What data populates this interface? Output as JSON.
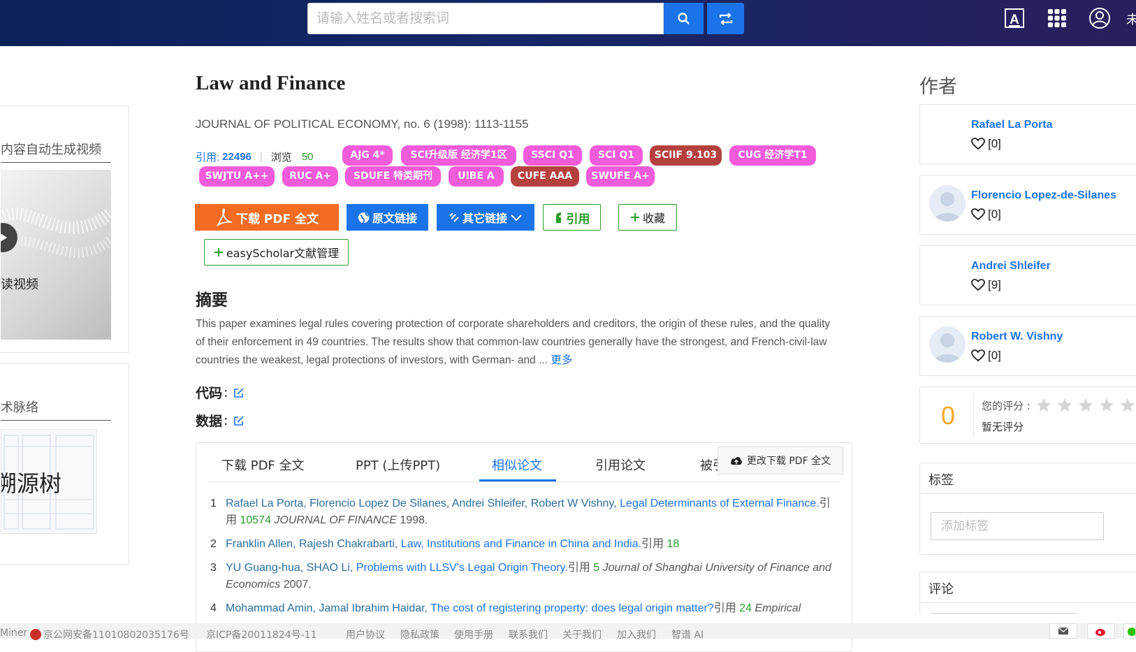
{
  "header": {
    "search_placeholder": "请输入姓名或者搜索词",
    "user_truncated": "未"
  },
  "left": {
    "video_card_title": "内容自动生成视频",
    "video_caption": "读视频",
    "map_card_title": "术脉络",
    "map_caption": "溯源树"
  },
  "paper": {
    "title": "Law and Finance",
    "journal": "JOURNAL OF POLITICAL ECONOMY, no. 6 (1998): 1113-1155",
    "cite_label": "引用:",
    "cite_count": "22496",
    "views_label": "浏览",
    "views_count": "50"
  },
  "tags": [
    {
      "label": "AJG 4*",
      "color": "#f25bd9"
    },
    {
      "label": "SCI升级版 经济学1区",
      "color": "#f25bd9"
    },
    {
      "label": "SSCI Q1",
      "color": "#f25bd9"
    },
    {
      "label": "SCI Q1",
      "color": "#f25bd9"
    },
    {
      "label": "SCIIF 9.103",
      "color": "#b5413f"
    },
    {
      "label": "CUG 经济学T1",
      "color": "#f25bd9"
    },
    {
      "label": "SWJTU A++",
      "color": "#f25bd9"
    },
    {
      "label": "RUC A+",
      "color": "#f25bd9"
    },
    {
      "label": "SDUFE 特类期刊",
      "color": "#f25bd9"
    },
    {
      "label": "UIBE A",
      "color": "#f25bd9"
    },
    {
      "label": "CUFE AAA",
      "color": "#b5413f"
    },
    {
      "label": "SWUFE A+",
      "color": "#f25bd9"
    }
  ],
  "actions": {
    "download_pdf": "下载 PDF 全文",
    "original_link": "原文链接",
    "other_links": "其它链接",
    "cite": "引用",
    "favorite": "收藏",
    "easyscholar": "easyScholar文献管理"
  },
  "abstract": {
    "heading": "摘要",
    "text": "This paper examines legal rules covering protection of corporate shareholders and creditors, the origin of these rules, and the quality of their enforcement in 49 countries. The results show that common-law countries generally have the strongest, and French-civil-law countries the weakest, legal protections of investors, with German- and ...",
    "more": "更多"
  },
  "code_label": "代码",
  "data_label": "数据",
  "colon": ":",
  "tabs": {
    "items": [
      "下载 PDF 全文",
      "PPT (上传PPT)",
      "相似论文",
      "引用论文",
      "被引"
    ],
    "active": "相似论文",
    "overlay_button": "更改下载 PDF 全文"
  },
  "references": [
    {
      "num": "1",
      "authors": "Rafael La Porta, Florencio Lopez De Silanes, Andrei Shleifer, Robert W Vishny,",
      "title": "Legal Determinants of External Finance.",
      "cite_label": "引用",
      "cites": "10574",
      "journal": "JOURNAL OF FINANCE",
      "year": "1998."
    },
    {
      "num": "2",
      "authors": "Franklin Allen, Rajesh Chakrabarti,",
      "title": "Law, Institutions and Finance in China and India.",
      "cite_label": "引用",
      "cites": "18",
      "journal": "",
      "year": ""
    },
    {
      "num": "3",
      "authors": "YU Guang-hua, SHAO Li,",
      "title": "Problems with LLSV's Legal Origin Theory.",
      "cite_label": "引用",
      "cites": "5",
      "journal": "Journal of Shanghai University of Finance and Economics",
      "year": "2007."
    },
    {
      "num": "4",
      "authors": "Mohammad Amin, Jamal Ibrahim Haidar,",
      "title": "The cost of registering property: does legal origin matter?",
      "cite_label": "引用",
      "cites": "24",
      "journal": "Empirical",
      "year": ""
    }
  ],
  "authors_section": {
    "heading": "作者",
    "authors": [
      {
        "name": "Rafael La Porta",
        "likes": "[0]"
      },
      {
        "name": "Florencio Lopez-de-Silanes",
        "likes": "[0]"
      },
      {
        "name": "Andrei Shleifer",
        "likes": "[9]"
      },
      {
        "name": "Robert W. Vishny",
        "likes": "[0]"
      }
    ]
  },
  "rating": {
    "score": "0",
    "your_rating_label": "您的评分 :",
    "no_rating": "暂无评分"
  },
  "tags_panel": {
    "heading": "标签",
    "placeholder": "添加标签"
  },
  "comments_panel": {
    "heading": "评论"
  },
  "footer": {
    "brand": "Miner",
    "police_record": "京公网安备11010802035176号",
    "icp": "京ICP备20011824号-11",
    "links": [
      "用户协议",
      "隐私政策",
      "使用手册",
      "联系我们",
      "关于我们",
      "加入我们",
      "智谱 AI"
    ]
  },
  "colors": {
    "accent": "#1a73e8",
    "pdf_orange": "#f36c21",
    "green": "#2a9d2a",
    "magenta": "#f25bd9",
    "maroon": "#b5413f"
  }
}
